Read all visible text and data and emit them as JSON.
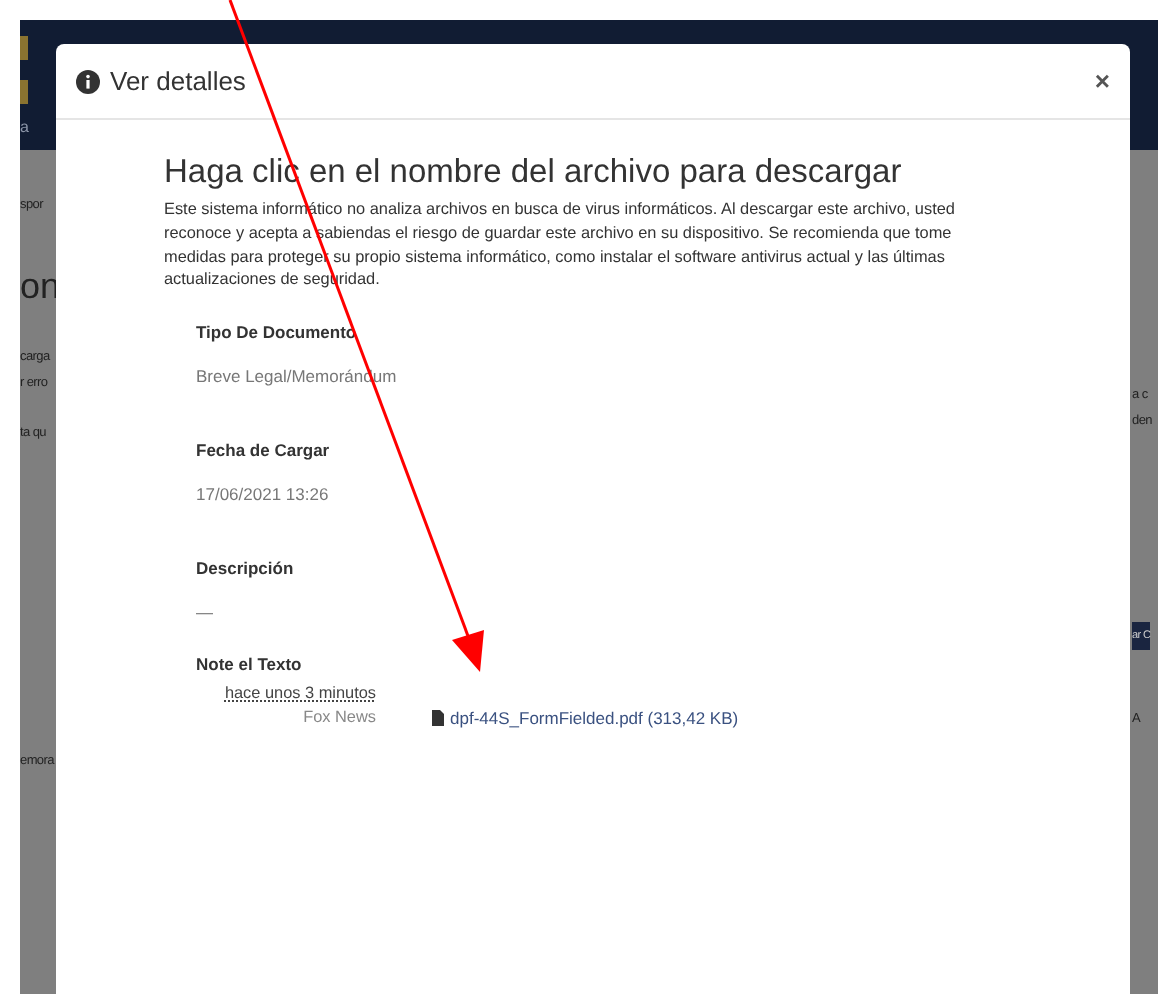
{
  "background": {
    "left_fragments": [
      {
        "text": "a",
        "kind": "header"
      },
      {
        "text": "spor",
        "kind": "small"
      },
      {
        "text": "on",
        "kind": "large"
      },
      {
        "text": "carga",
        "kind": "small"
      },
      {
        "text": "r erro",
        "kind": "small"
      },
      {
        "text": "ta qu",
        "kind": "small"
      },
      {
        "text": "emora",
        "kind": "small"
      }
    ],
    "right_fragments": [
      {
        "text": "a c",
        "kind": "small"
      },
      {
        "text": "den",
        "kind": "small"
      },
      {
        "text": "ar C",
        "kind": "button"
      },
      {
        "text": "A",
        "kind": "small"
      }
    ]
  },
  "modal": {
    "title": "Ver detalles",
    "close": "×",
    "heading": "Haga clic en el nombre del archivo para descargar",
    "notice": "Este sistema informático no analiza archivos en busca de virus informáticos. Al descargar este archivo, usted reconoce y acepta a sabiendas el riesgo de guardar este archivo en su dispositivo. Se recomienda que tome medidas para proteger su propio sistema informático, como instalar el software antivirus actual y las últimas actualizaciones de seguridad.",
    "fields": [
      {
        "label": "Tipo De Documento",
        "value": "Breve Legal/Memorándum"
      },
      {
        "label": "Fecha de Cargar",
        "value": "17/06/2021 13:26"
      },
      {
        "label": "Descripción",
        "value": "—"
      }
    ],
    "note": {
      "label": "Note el Texto",
      "time": "hace unos 3 minutos",
      "author": "Fox News",
      "file": "dpf-44S_FormFielded.pdf (313,42 KB)"
    }
  }
}
